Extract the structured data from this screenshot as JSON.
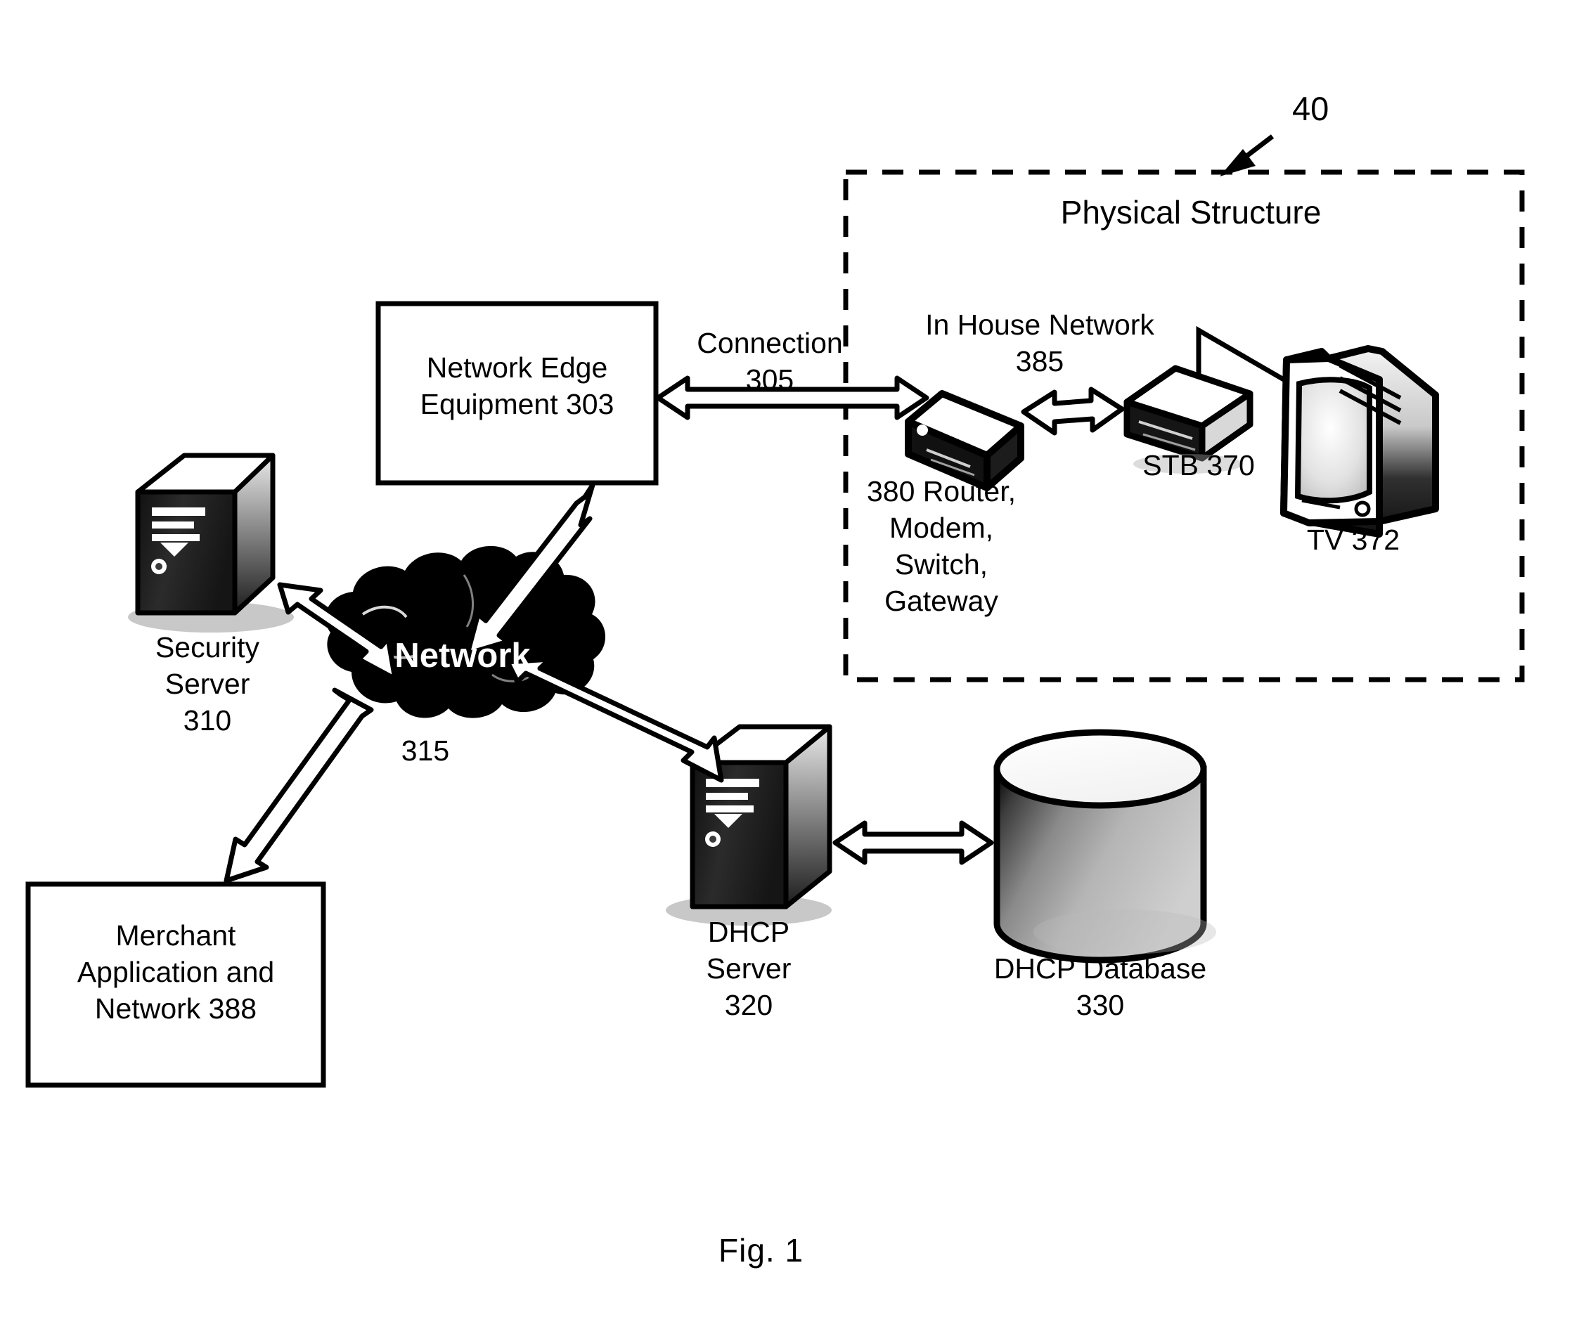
{
  "figure": {
    "caption": "Fig. 1",
    "reference_numeral": "40"
  },
  "physical_structure": {
    "title": "Physical Structure",
    "numeral": "40"
  },
  "nodes": {
    "network_edge_equipment": {
      "line1": "Network Edge",
      "line2": "Equipment 303"
    },
    "security_server": {
      "line1": "Security",
      "line2": "Server",
      "line3": "310"
    },
    "network_cloud": {
      "label": "Network",
      "numeral": "315"
    },
    "merchant_application": {
      "line1": "Merchant",
      "line2": "Application and",
      "line3": "Network 388"
    },
    "dhcp_server": {
      "line1": "DHCP",
      "line2": "Server",
      "line3": "320"
    },
    "dhcp_database": {
      "line1": "DHCP Database",
      "line2": "330"
    },
    "router": {
      "line1": "380 Router,",
      "line2": "Modem,",
      "line3": "Switch,",
      "line4": "Gateway"
    },
    "stb": {
      "label": "STB 370"
    },
    "tv": {
      "label": "TV 372"
    }
  },
  "connections": {
    "connection_305": {
      "line1": "Connection",
      "line2": "305"
    },
    "in_house_network_385": {
      "line1": "In House Network",
      "line2": "385"
    }
  },
  "colors": {
    "ink": "#000000",
    "paper": "#ffffff"
  }
}
